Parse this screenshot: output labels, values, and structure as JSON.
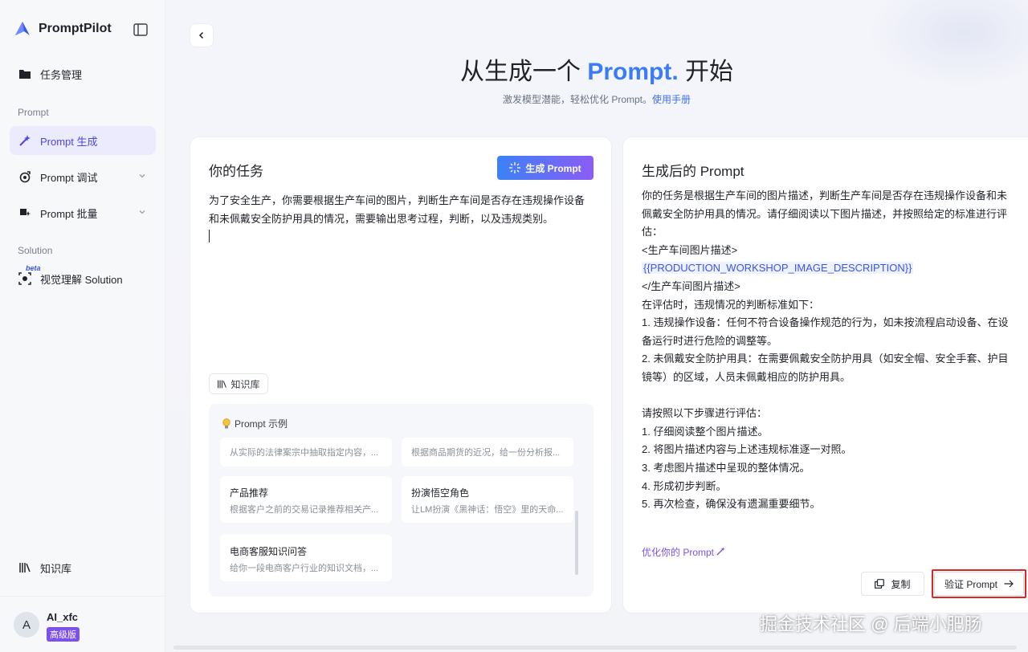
{
  "app": {
    "name": "PromptPilot"
  },
  "sidebar": {
    "task_mgmt": "任务管理",
    "section_prompt": "Prompt",
    "items": [
      {
        "label": "Prompt 生成",
        "active": true
      },
      {
        "label": "Prompt 调试"
      },
      {
        "label": "Prompt 批量"
      }
    ],
    "section_solution": "Solution",
    "visual_solution": "视觉理解 Solution",
    "beta": "beta",
    "knowledge_base": "知识库"
  },
  "user": {
    "avatar": "A",
    "name": "AI_xfc",
    "plan": "高级版"
  },
  "hero": {
    "title_before": "从生成一个 ",
    "title_accent": "Prompt.",
    "title_after": " 开始",
    "subtitle": "激发模型潜能，轻松优化 Prompt。",
    "manual_link": "使用手册"
  },
  "task_panel": {
    "title": "你的任务",
    "generate_button": "生成 Prompt",
    "task_text": "为了安全生产，你需要根据生产车间的图片，判断生产车间是否存在违规操作设备和未佩戴安全防护用具的情况，需要输出思考过程，判断，以及违规类别。",
    "kb_button": "知识库",
    "examples_title": "Prompt 示例",
    "examples": [
      {
        "title": "",
        "desc": "从实际的法律案宗中抽取指定内容，..."
      },
      {
        "title": "",
        "desc": "根据商品期货的近况，给一份分析报..."
      },
      {
        "title": "产品推荐",
        "desc": "根据客户之前的交易记录推荐相关产..."
      },
      {
        "title": "扮演悟空角色",
        "desc": "让LM扮演《黑神话：悟空》里的天命..."
      },
      {
        "title": "电商客服知识问答",
        "desc": "给你一段电商客户行业的知识文档，..."
      }
    ]
  },
  "output_panel": {
    "title": "生成后的 Prompt",
    "lines": [
      "你的任务是根据生产车间的图片描述，判断生产车间是否存在违规操作设备和未佩戴安全防护用具的情况。请仔细阅读以下图片描述，并按照给定的标准进行评估：",
      "<生产车间图片描述>",
      "{{PRODUCTION_WORKSHOP_IMAGE_DESCRIPTION}}",
      "</生产车间图片描述>",
      "在评估时，违规情况的判断标准如下：",
      "1. 违规操作设备：任何不符合设备操作规范的行为，如未按流程启动设备、在设备运行时进行危险的调整等。",
      "2. 未佩戴安全防护用具：在需要佩戴安全防护用具（如安全帽、安全手套、护目镜等）的区域，人员未佩戴相应的防护用具。",
      "",
      "请按照以下步骤进行评估：",
      "1. 仔细阅读整个图片描述。",
      "2. 将图片描述内容与上述违规标准逐一对照。",
      "3. 考虑图片描述中呈现的整体情况。",
      "4. 形成初步判断。",
      "5. 再次检查，确保没有遗漏重要细节。"
    ],
    "optimize_link": "优化你的 Prompt",
    "copy_button": "复制",
    "verify_button": "验证 Prompt"
  },
  "watermark": "掘金技术社区 @ 后端小肥肠",
  "colors": {
    "accent": "#3b7bf6",
    "active_nav": "#4e46e5",
    "highlight": "#e02424",
    "premium": "#7b4ff0"
  }
}
